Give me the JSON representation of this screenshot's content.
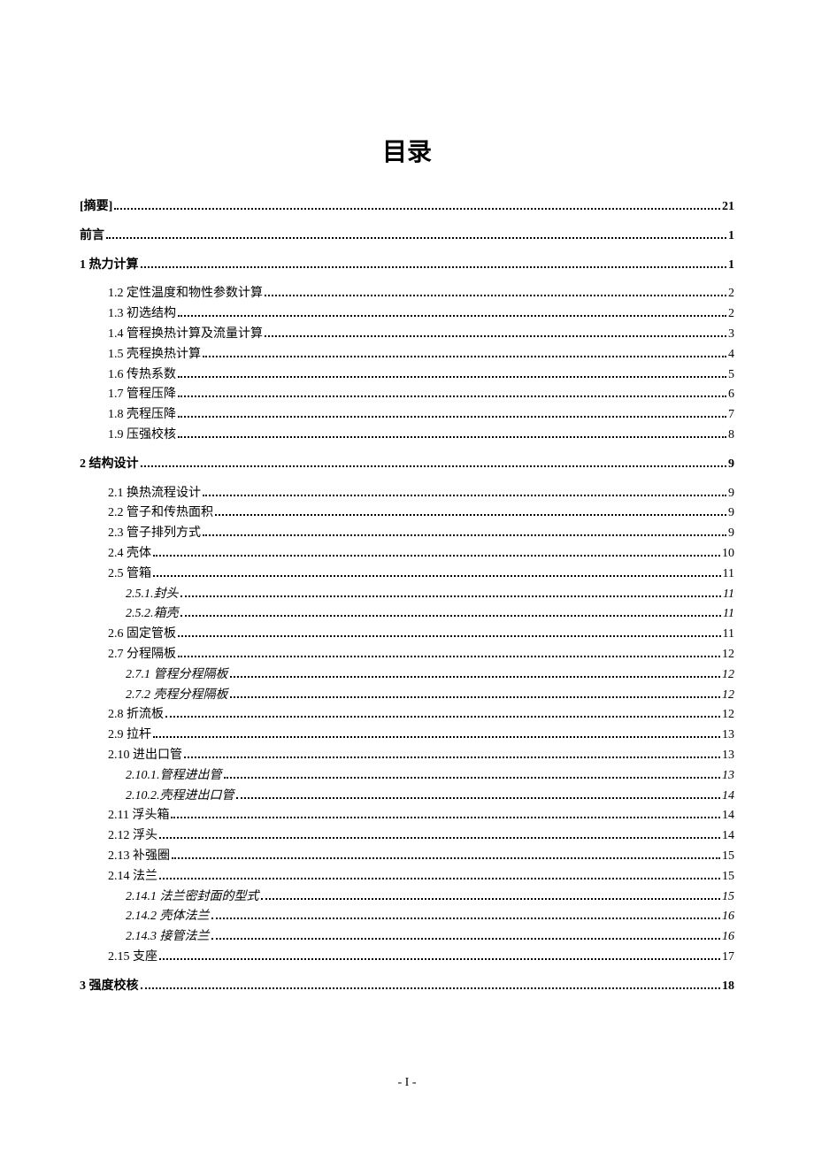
{
  "title": "目录",
  "page_number": "- I -",
  "toc": [
    {
      "level": 0,
      "label": "[摘要]",
      "page": "21",
      "spacer_before": false
    },
    {
      "level": 0,
      "label": "前言",
      "page": "1",
      "spacer_before": true
    },
    {
      "level": 0,
      "label": "1 热力计算",
      "page": "1",
      "spacer_before": true
    },
    {
      "level": 1,
      "label": "1.2 定性温度和物性参数计算",
      "page": "2",
      "spacer_before": true
    },
    {
      "level": 1,
      "label": "1.3 初选结构",
      "page": "2",
      "spacer_before": false
    },
    {
      "level": 1,
      "label": "1.4 管程换热计算及流量计算",
      "page": "3",
      "spacer_before": false
    },
    {
      "level": 1,
      "label": "1.5 壳程换热计算",
      "page": "4",
      "spacer_before": false
    },
    {
      "level": 1,
      "label": "1.6 传热系数",
      "page": "5",
      "spacer_before": false
    },
    {
      "level": 1,
      "label": "1.7 管程压降",
      "page": "6",
      "spacer_before": false
    },
    {
      "level": 1,
      "label": "1.8 壳程压降",
      "page": "7",
      "spacer_before": false
    },
    {
      "level": 1,
      "label": "1.9 压强校核",
      "page": "8",
      "spacer_before": false
    },
    {
      "level": 0,
      "label": "2 结构设计",
      "page": "9",
      "spacer_before": true
    },
    {
      "level": 1,
      "label": "2.1 换热流程设计",
      "page": "9",
      "spacer_before": true
    },
    {
      "level": 1,
      "label": "2.2 管子和传热面积",
      "page": "9",
      "spacer_before": false
    },
    {
      "level": 1,
      "label": "2.3 管子排列方式",
      "page": "9",
      "spacer_before": false
    },
    {
      "level": 1,
      "label": "2.4 壳体",
      "page": "10",
      "spacer_before": false
    },
    {
      "level": 1,
      "label": "2.5 管箱",
      "page": "11",
      "spacer_before": false
    },
    {
      "level": 2,
      "label": "2.5.1.封头",
      "page": "11",
      "spacer_before": false
    },
    {
      "level": 2,
      "label": "2.5.2.箱壳",
      "page": "11",
      "spacer_before": false
    },
    {
      "level": 1,
      "label": "2.6 固定管板",
      "page": "11",
      "spacer_before": false
    },
    {
      "level": 1,
      "label": "2.7 分程隔板",
      "page": "12",
      "spacer_before": false
    },
    {
      "level": 2,
      "label": "2.7.1 管程分程隔板",
      "page": "12",
      "spacer_before": false
    },
    {
      "level": 2,
      "label": "2.7.2 壳程分程隔板",
      "page": "12",
      "spacer_before": false
    },
    {
      "level": 1,
      "label": "2.8 折流板",
      "page": "12",
      "spacer_before": false
    },
    {
      "level": 1,
      "label": "2.9 拉杆",
      "page": "13",
      "spacer_before": false
    },
    {
      "level": 1,
      "label": "2.10 进出口管",
      "page": "13",
      "spacer_before": false
    },
    {
      "level": 2,
      "label": "2.10.1.管程进出管",
      "page": "13",
      "spacer_before": false
    },
    {
      "level": 2,
      "label": "2.10.2.壳程进出口管",
      "page": "14",
      "spacer_before": false
    },
    {
      "level": 1,
      "label": "2.11 浮头箱",
      "page": "14",
      "spacer_before": false
    },
    {
      "level": 1,
      "label": "2.12 浮头",
      "page": "14",
      "spacer_before": false
    },
    {
      "level": 1,
      "label": "2.13 补强圈",
      "page": "15",
      "spacer_before": false
    },
    {
      "level": 1,
      "label": "2.14 法兰",
      "page": "15",
      "spacer_before": false
    },
    {
      "level": 2,
      "label": "2.14.1 法兰密封面的型式",
      "page": "15",
      "spacer_before": false
    },
    {
      "level": 2,
      "label": "2.14.2 壳体法兰",
      "page": "16",
      "spacer_before": false
    },
    {
      "level": 2,
      "label": "2.14.3 接管法兰",
      "page": "16",
      "spacer_before": false
    },
    {
      "level": 1,
      "label": "2.15 支座",
      "page": "17",
      "spacer_before": false
    },
    {
      "level": 0,
      "label": "3 强度校核",
      "page": "18",
      "spacer_before": true
    }
  ]
}
